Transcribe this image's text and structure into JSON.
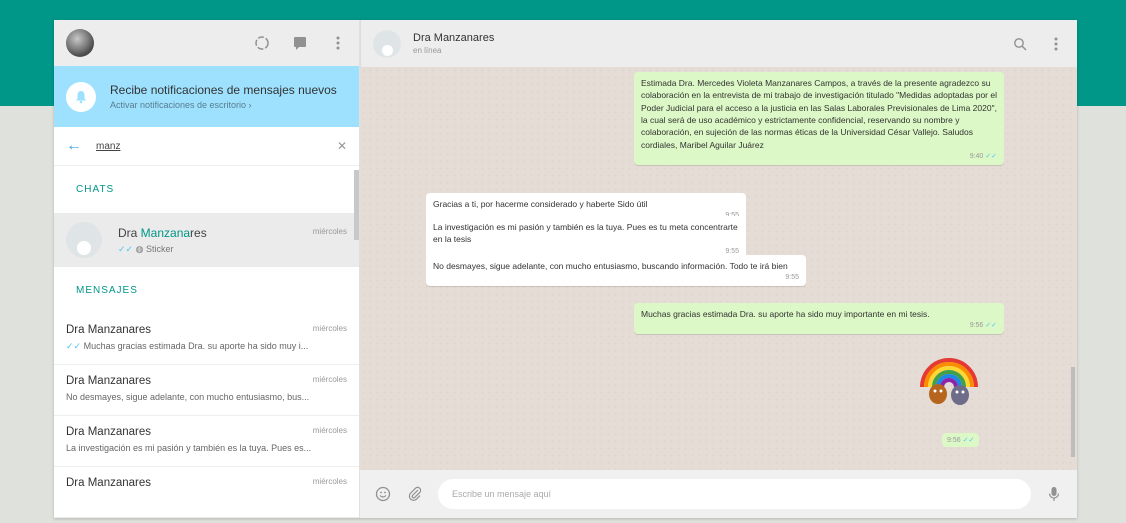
{
  "left": {
    "notification": {
      "title": "Recibe notificaciones de mensajes nuevos",
      "subtitle": "Activar notificaciones de escritorio ›"
    },
    "search": {
      "value": "manz"
    },
    "chats_label": "CHATS",
    "chat": {
      "name_prefix": "Dra ",
      "name_highlight": "Manzana",
      "name_suffix": "res",
      "time": "miércoles",
      "status": "Sticker"
    },
    "messages_label": "MENSAJES",
    "messages": [
      {
        "name": "Dra Manzanares",
        "time": "miércoles",
        "snippet": "Muchas gracias estimada Dra. su aporte ha sido muy i..."
      },
      {
        "name": "Dra Manzanares",
        "time": "miércoles",
        "snippet": "No desmayes, sigue adelante, con mucho entusiasmo, bus..."
      },
      {
        "name": "Dra Manzanares",
        "time": "miércoles",
        "snippet": "La investigación es mi pasión y también es la tuya. Pues es..."
      },
      {
        "name": "Dra Manzanares",
        "time": "miércoles",
        "snippet": ""
      }
    ]
  },
  "right": {
    "contact_name": "Dra Manzanares",
    "contact_status": "en línea",
    "messages": [
      {
        "text": "Estimada Dra. Mercedes Violeta Manzanares Campos, a través de la presente agradezco su colaboración en la entrevista de mi trabajo de investigación titulado \"Medidas adoptadas por el Poder Judicial para el acceso a la justicia en las Salas Laborales Previsionales de Lima 2020\", la cual será de uso académico y estrictamente confidencial, reservando su nombre y colaboración, en sujeción de las normas éticas de la Universidad César Vallejo. Saludos cordiales, Maribel Aguilar Juárez",
        "time": "9:40"
      },
      {
        "text": "Gracias a ti, por hacerme considerado y haberte Sido útil",
        "time": "9:55"
      },
      {
        "text": "La investigación es mi pasión y también es la tuya. Pues es tu meta concentrarte en la tesis",
        "time": "9:55"
      },
      {
        "text": "No desmayes, sigue adelante, con mucho entusiasmo, buscando información. Todo te irá bien",
        "time": "9:55"
      },
      {
        "text": "Muchas gracias estimada Dra. su aporte ha sido muy importante en mi tesis.",
        "time": "9:56"
      }
    ],
    "sticker_time": "9:56",
    "composer_placeholder": "Escribe un mensaje aquí"
  },
  "colors": {
    "accent": "#009688",
    "outgoing": "#dcf8c6",
    "notification": "#9de1fe",
    "chat_bg": "#e5ddd5"
  },
  "icons": [
    "status-icon",
    "new-chat-icon",
    "menu-icon",
    "bell-off-icon",
    "back-arrow-icon",
    "clear-icon",
    "search-icon",
    "emoji-icon",
    "attach-icon",
    "mic-icon",
    "double-check-icon",
    "sticker-icon"
  ]
}
